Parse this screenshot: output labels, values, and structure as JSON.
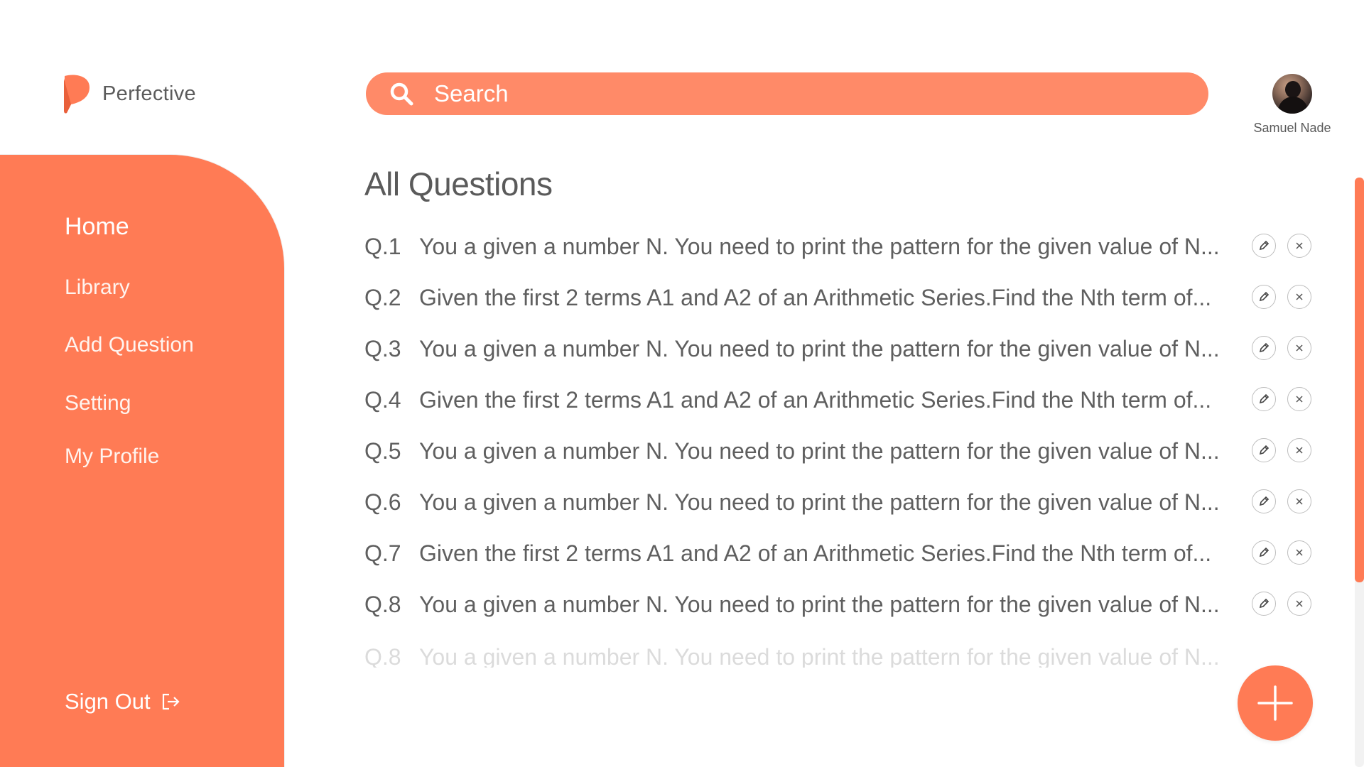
{
  "brand": {
    "name": "Perfective"
  },
  "search": {
    "placeholder": "Search"
  },
  "user": {
    "name": "Samuel Nade"
  },
  "sidebar": {
    "items": [
      {
        "label": "Home",
        "active": true
      },
      {
        "label": "Library"
      },
      {
        "label": "Add Question"
      },
      {
        "label": "Setting"
      },
      {
        "label": "My Profile"
      }
    ],
    "signout_label": "Sign Out"
  },
  "main": {
    "title": "All Questions",
    "questions": [
      {
        "num": "Q.1",
        "text": "You a given a number N. You need to print the pattern for the given value of N..."
      },
      {
        "num": "Q.2",
        "text": "Given the first 2 terms A1 and A2 of an Arithmetic Series.Find the Nth term of..."
      },
      {
        "num": "Q.3",
        "text": "You a given a number N. You need to print the pattern for the given value of N..."
      },
      {
        "num": "Q.4",
        "text": "Given the first 2 terms A1 and A2 of an Arithmetic Series.Find the Nth term of..."
      },
      {
        "num": "Q.5",
        "text": "You a given a number N. You need to print the pattern for the given value of N..."
      },
      {
        "num": "Q.6",
        "text": "You a given a number N. You need to print the pattern for the given value of N..."
      },
      {
        "num": "Q.7",
        "text": "Given the first 2 terms A1 and A2 of an Arithmetic Series.Find the Nth term of..."
      },
      {
        "num": "Q.8",
        "text": "You a given a number N. You need to print the pattern for the given value of N..."
      },
      {
        "num": "Q.8",
        "text": "You a given a number N. You need to print the pattern for the given value of N..."
      }
    ]
  },
  "colors": {
    "accent": "#ff7b55",
    "search_bg": "#ff8a68",
    "text": "#5f5f5f"
  },
  "icons": {
    "logo": "perfective-logo-icon",
    "search": "search-icon",
    "edit": "pencil-icon",
    "delete": "close-icon",
    "signout": "sign-out-icon",
    "add": "plus-icon"
  }
}
